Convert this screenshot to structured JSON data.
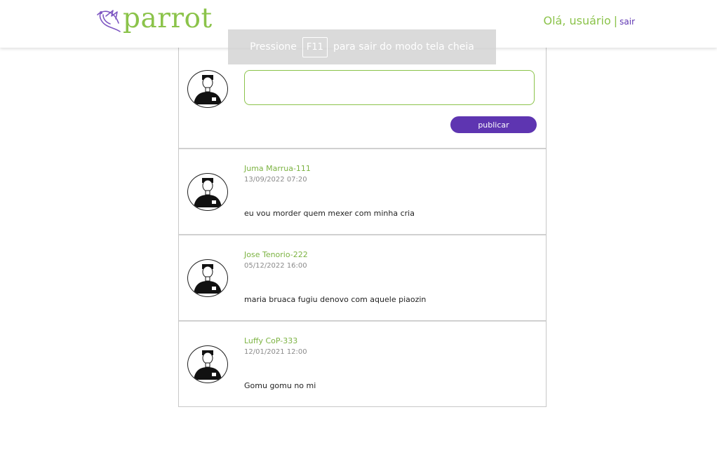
{
  "header": {
    "logo_text": "parrot",
    "greeting": "Olá, usuário",
    "separator": "|",
    "logout_label": "sair"
  },
  "composer": {
    "input_value": "",
    "publish_label": "publicar"
  },
  "posts": [
    {
      "author": "Juma Marrua-111",
      "date": "13/09/2022 07:20",
      "text": "eu vou morder quem mexer com minha cria"
    },
    {
      "author": "Jose Tenorio-222",
      "date": "05/12/2022 16:00",
      "text": "maria bruaca fugiu denovo com aquele piaozin"
    },
    {
      "author": "Luffy CoP-333",
      "date": "12/01/2021 12:00",
      "text": "Gomu gomu no mi"
    }
  ],
  "fullscreen_notice": {
    "before": "Pressione",
    "key": "F11",
    "after": "para sair do modo tela cheia"
  },
  "colors": {
    "brand_green": "#8bc34a",
    "brand_purple": "#5e35b1"
  },
  "icons": [
    "parrot-logo-icon",
    "user-avatar"
  ]
}
